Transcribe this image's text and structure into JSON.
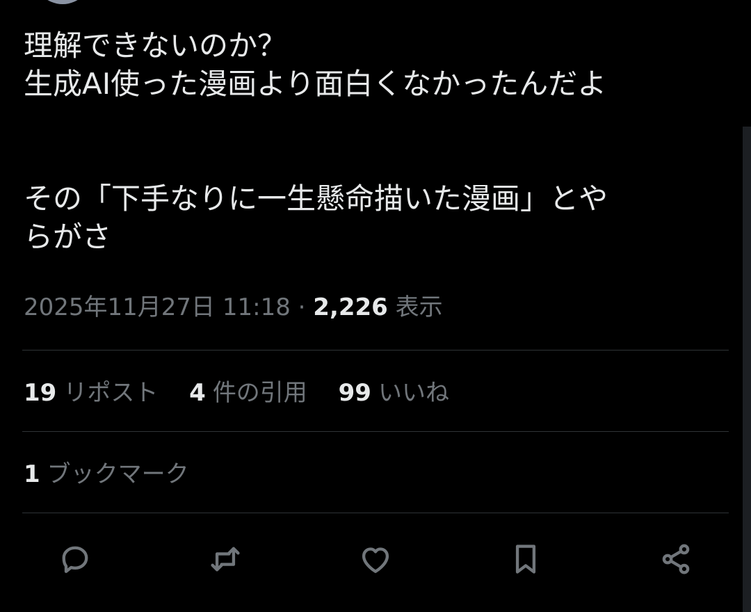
{
  "tweet": {
    "lines": [
      "理解できないのか？",
      "生成AI使った漫画より面白くなかったんだよ",
      "その「下手なりに一生懸命描いた漫画」とや",
      "らがさ"
    ]
  },
  "meta": {
    "datetime": "2025年11月27日 11:18",
    "separator": "·",
    "views_count": "2,226",
    "views_label": "表示"
  },
  "stats": {
    "reposts_count": "19",
    "reposts_label": "リポスト",
    "quotes_count": "4",
    "quotes_label": "件の引用",
    "likes_count": "99",
    "likes_label": "いいね",
    "bookmarks_count": "1",
    "bookmarks_label": "ブックマーク"
  },
  "actions": [
    "reply-icon",
    "repost-icon",
    "like-icon",
    "bookmark-icon",
    "share-icon"
  ],
  "colors": {
    "background": "#000000",
    "text_primary": "#e7e9ea",
    "text_secondary": "#71767b",
    "divider": "#2f3336"
  }
}
